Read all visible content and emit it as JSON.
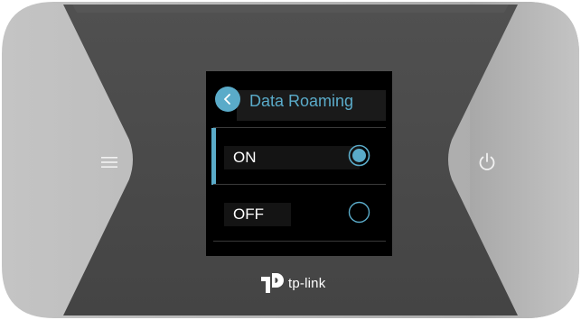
{
  "screen": {
    "title": "Data Roaming",
    "options": [
      {
        "label": "ON",
        "selected": true
      },
      {
        "label": "OFF",
        "selected": false
      }
    ]
  },
  "device": {
    "brand": "tp-link",
    "menu_icon": "hamburger-menu-icon",
    "power_icon": "power-icon",
    "back_icon": "chevron-left-icon"
  },
  "colors": {
    "accent": "#5aabc9",
    "screen_bg": "#000000",
    "panel": "#4a4a4a",
    "side": "#b8b8b8"
  }
}
